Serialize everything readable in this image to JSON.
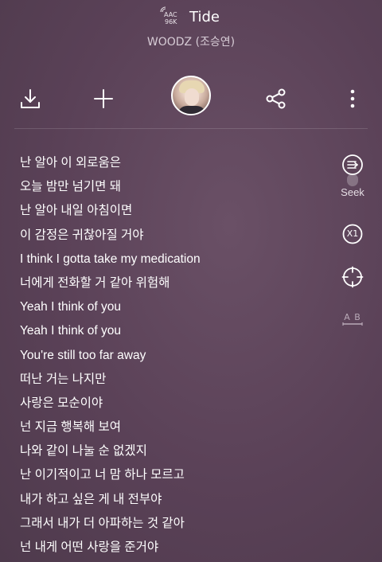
{
  "header": {
    "codec_line1": "AAC",
    "codec_line2": "96K",
    "title": "Tide",
    "artist": "WOODZ (조승연)"
  },
  "toolbar": {
    "icons": [
      "download-icon",
      "add-icon",
      "share-icon",
      "more-vert-icon"
    ]
  },
  "lyrics": [
    "난 알아 이 외로움은",
    "오늘 밤만 넘기면 돼",
    "난 알아 내일 아침이면",
    "이 감정은 귀찮아질 거야",
    "I think I gotta take my medication",
    "너에게 전화할 거 같아 위험해",
    "Yeah I think of you",
    "Yeah I think of you",
    "You're still too far away",
    "떠난 거는 나지만",
    "사랑은 모순이야",
    "넌 지금 행복해 보여",
    "나와 같이 나눌 순 없겠지",
    "난 이기적이고 너 맘 하나 모르고",
    "내가 하고 싶은 게 내 전부야",
    "그래서 내가 더 아파하는 것 같아",
    "넌 내게 어떤 사랑을 준거야"
  ],
  "side": {
    "seek_label": "Seek",
    "speed_label": "X1",
    "ab_label": "A B"
  }
}
